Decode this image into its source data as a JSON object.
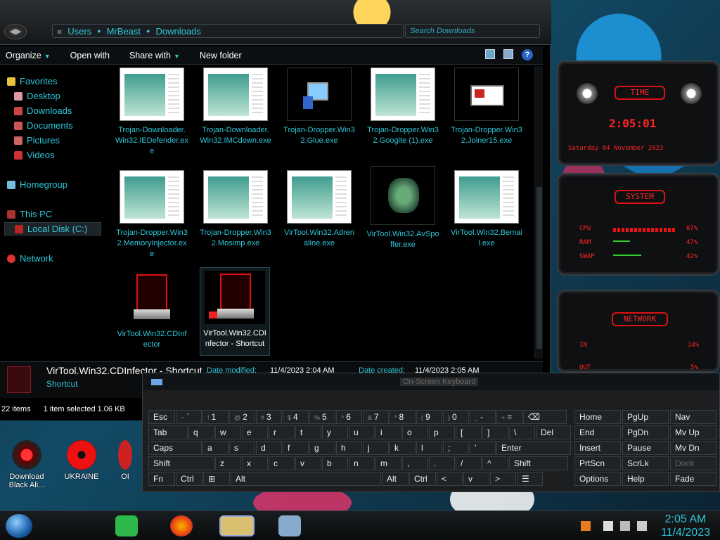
{
  "explorer": {
    "address": [
      "Users",
      "MrBeast",
      "Downloads"
    ],
    "search_placeholder": "Search Downloads",
    "toolbar": {
      "organize": "Organize",
      "open_with": "Open with",
      "share_with": "Share with",
      "new_folder": "New folder"
    },
    "nav": {
      "favorites": "Favorites",
      "desktop": "Desktop",
      "downloads": "Downloads",
      "documents": "Documents",
      "pictures": "Pictures",
      "videos": "Videos",
      "homegroup": "Homegroup",
      "this_pc": "This PC",
      "local_disk": "Local Disk (C:)",
      "network": "Network"
    },
    "files": [
      {
        "name": "Trojan-Downloader.Win32.IEDefender.exe"
      },
      {
        "name": "Trojan-Downloader.Win32.IMCdown.exe"
      },
      {
        "name": "Trojan-Dropper.Win32.Glue.exe"
      },
      {
        "name": "Trojan-Dropper.Win32.Googite (1).exe"
      },
      {
        "name": "Trojan-Dropper.Win32.Joiner15.exe"
      },
      {
        "name": "Trojan-Dropper.Win32.MemoryInjector.exe"
      },
      {
        "name": "Trojan-Dropper.Win32.Mosimp.exe"
      },
      {
        "name": "VirTool.Win32.Adrenaline.exe"
      },
      {
        "name": "VirTool.Win32.AvSpoffer.exe"
      },
      {
        "name": "VirTool.Win32.Bemail.exe"
      },
      {
        "name": "VirTool.Win32.CDInfector"
      },
      {
        "name": "VirTool.Win32.CDInfector - Shortcut"
      }
    ],
    "details": {
      "name": "VirTool.Win32.CDInfector - Shortcut",
      "type": "Shortcut",
      "date_modified_label": "Date modified:",
      "date_modified": "11/4/2023 2:04 AM",
      "date_created_label": "Date created:",
      "date_created": "11/4/2023 2:05 AM"
    },
    "status": {
      "items": "22 items",
      "selected": "1 item selected 1.06 KB"
    }
  },
  "desktop_icons": [
    {
      "label": "Download Black Ali..."
    },
    {
      "label": "UKRAINE"
    },
    {
      "label": "OI"
    }
  ],
  "gadgets": {
    "time": {
      "title": "TIME",
      "clock": "2:05:01",
      "date": "Saturday 04 November 2023"
    },
    "system": {
      "title": "SYSTEM",
      "rows": [
        {
          "label": "CPU",
          "value": "67%"
        },
        {
          "label": "RAM",
          "value": "47%"
        },
        {
          "label": "SWAP",
          "value": "42%"
        }
      ]
    },
    "network": {
      "title": "NETWORK",
      "rows": [
        {
          "label": "IN",
          "value": "14%"
        },
        {
          "label": "OUT",
          "value": "5%"
        }
      ]
    }
  },
  "osk": {
    "title": "On-Screen Keyboard",
    "row1": [
      [
        "Esc",
        ""
      ],
      [
        "`",
        "~"
      ],
      [
        "1",
        "!"
      ],
      [
        "2",
        "@"
      ],
      [
        "3",
        "#"
      ],
      [
        "4",
        "$"
      ],
      [
        "5",
        "%"
      ],
      [
        "6",
        "^"
      ],
      [
        "7",
        "&"
      ],
      [
        "8",
        "*"
      ],
      [
        "9",
        "("
      ],
      [
        "0",
        ")"
      ],
      [
        "-",
        "_"
      ],
      [
        "=",
        "+"
      ],
      [
        "⌫",
        ""
      ]
    ],
    "row2": [
      "Tab",
      "q",
      "w",
      "e",
      "r",
      "t",
      "y",
      "u",
      "i",
      "o",
      "p",
      "[",
      "]",
      "\\",
      "Del"
    ],
    "row3": [
      "Caps",
      "a",
      "s",
      "d",
      "f",
      "g",
      "h",
      "j",
      "k",
      "l",
      ";",
      "'",
      "Enter"
    ],
    "row4": [
      "Shift",
      "z",
      "x",
      "c",
      "v",
      "b",
      "n",
      "m",
      ",",
      ".",
      "/",
      "^",
      "Shift"
    ],
    "row5": [
      "Fn",
      "Ctrl",
      "⊞",
      "Alt",
      "Alt",
      "Ctrl",
      "<",
      "v",
      ">",
      "☰"
    ],
    "right": [
      [
        "Home",
        "PgUp",
        "Nav"
      ],
      [
        "End",
        "PgDn",
        "Mv Up"
      ],
      [
        "Insert",
        "Pause",
        "Mv Dn"
      ],
      [
        "PrtScn",
        "ScrLk",
        "Dock"
      ],
      [
        "Options",
        "Help",
        "Fade"
      ]
    ]
  },
  "taskbar": {
    "time": "2:05 AM",
    "date": "11/4/2023"
  }
}
